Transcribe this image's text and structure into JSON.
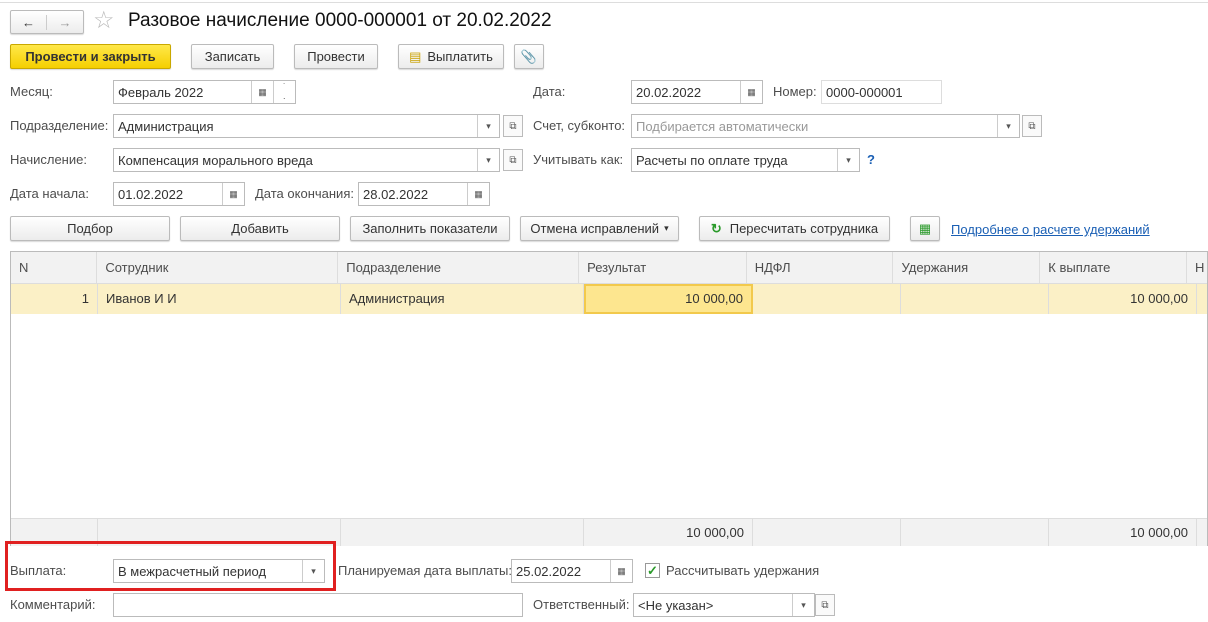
{
  "title": "Разовое начисление 0000-000001 от 20.02.2022",
  "toolbar": {
    "post_close": "Провести и закрыть",
    "save": "Записать",
    "post": "Провести",
    "pay": "Выплатить"
  },
  "form": {
    "month_label": "Месяц:",
    "month_value": "Февраль 2022",
    "date_label": "Дата:",
    "date_value": "20.02.2022",
    "number_label": "Номер:",
    "number_value": "0000-000001",
    "department_label": "Подразделение:",
    "department_value": "Администрация",
    "account_label": "Счет, субконто:",
    "account_placeholder": "Подбирается автоматически",
    "accrual_label": "Начисление:",
    "accrual_value": "Компенсация морального вреда",
    "account_as_label": "Учитывать как:",
    "account_as_value": "Расчеты по оплате труда",
    "help": "?",
    "start_label": "Дата начала:",
    "start_value": "01.02.2022",
    "end_label": "Дата окончания:",
    "end_value": "28.02.2022"
  },
  "table_toolbar": {
    "pick": "Подбор",
    "add": "Добавить",
    "fill": "Заполнить показатели",
    "cancel_fix": "Отмена исправлений",
    "recalc": "Пересчитать сотрудника",
    "link": "Подробнее о расчете удержаний"
  },
  "table": {
    "columns": [
      "N",
      "Сотрудник",
      "Подразделение",
      "Результат",
      "НДФЛ",
      "Удержания",
      "К выплате",
      "Н"
    ],
    "rows": [
      [
        "1",
        "Иванов И И",
        "Администрация",
        "10 000,00",
        "",
        "",
        "10 000,00",
        ""
      ]
    ],
    "totals": {
      "result": "10 000,00",
      "payout": "10 000,00"
    }
  },
  "bottom": {
    "payment_label": "Выплата:",
    "payment_value": "В межрасчетный период",
    "planned_label": "Планируемая дата выплаты:",
    "planned_value": "25.02.2022",
    "calc_deductions_label": "Рассчитывать удержания",
    "calc_deductions_checked": true,
    "comment_label": "Комментарий:",
    "comment_value": "",
    "responsible_label": "Ответственный:",
    "responsible_value": "<Не указан>"
  },
  "colors": {
    "highlight": "#e02020",
    "accent": "#f5cf00",
    "link": "#1a5fb4"
  }
}
